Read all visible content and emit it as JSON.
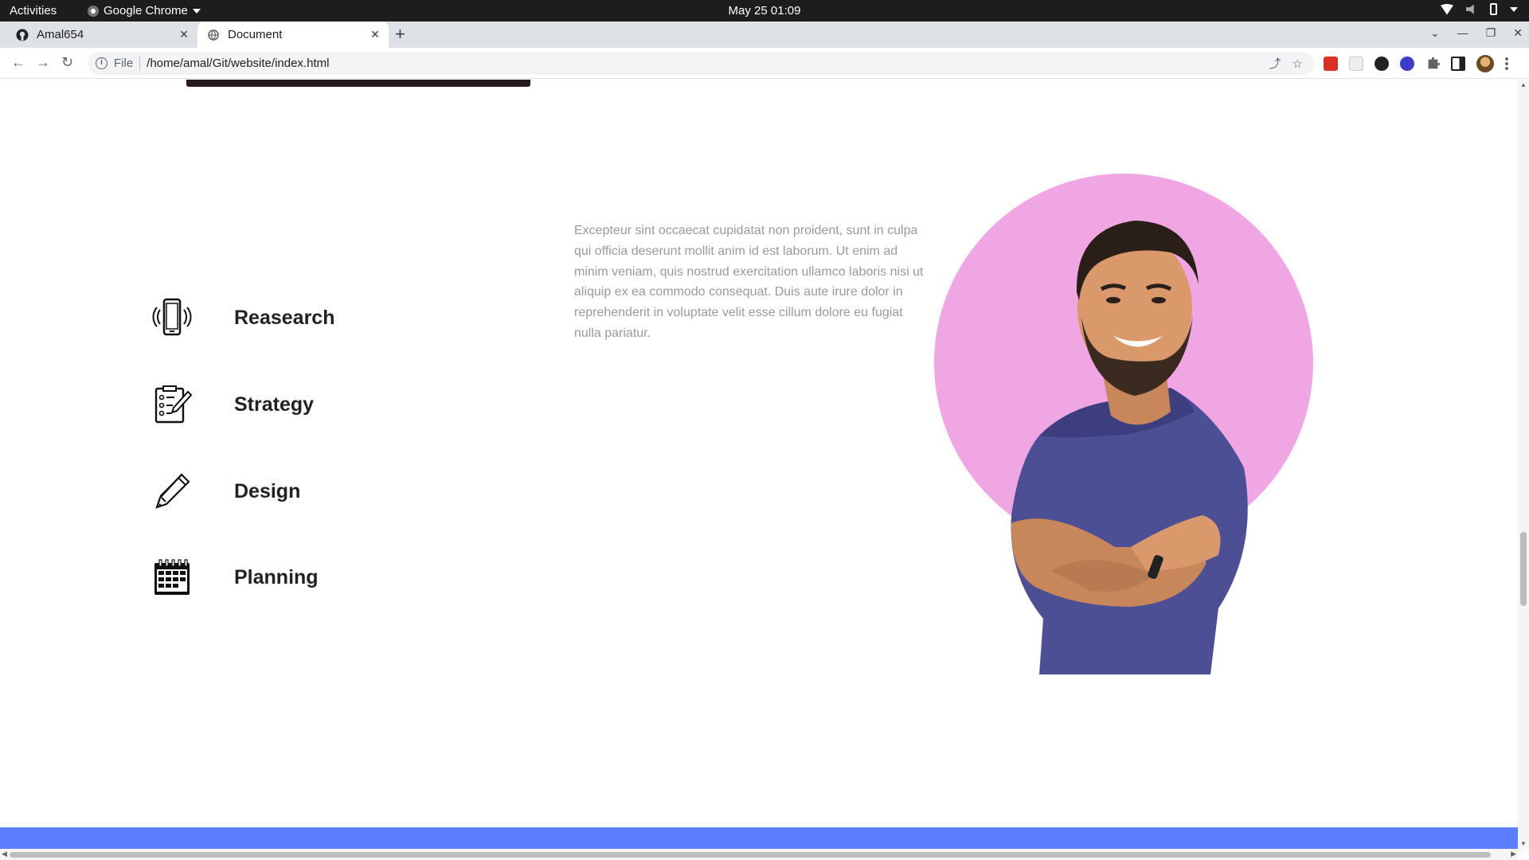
{
  "os": {
    "activities": "Activities",
    "app_name": "Google Chrome",
    "clock": "May 25  01:09"
  },
  "browser": {
    "tabs": [
      {
        "title": "Amal654",
        "icon": "github-icon",
        "active": false
      },
      {
        "title": "Document",
        "icon": "globe-icon",
        "active": true
      }
    ],
    "address": {
      "scheme": "File",
      "url": "/home/amal/Git/website/index.html"
    },
    "extensions": [
      "red-extension-icon",
      "blank-extension-icon",
      "openai-extension-icon",
      "blue-extension-icon",
      "puzzle-icon",
      "side-panel-icon",
      "profile-avatar",
      "menu-icon"
    ]
  },
  "page": {
    "services": [
      {
        "label": "Reasearch",
        "icon": "smartphone-vibrate-icon"
      },
      {
        "label": "Strategy",
        "icon": "checklist-pencil-icon"
      },
      {
        "label": "Design",
        "icon": "pencil-icon"
      },
      {
        "label": "Planning",
        "icon": "calendar-icon"
      }
    ],
    "paragraph": "Excepteur sint occaecat cupidatat non proident, sunt in culpa qui officia deserunt mollit anim id est laborum. Ut enim ad minim veniam, quis nostrud exercitation ullamco laboris nisi ut aliquip ex ea commodo consequat. Duis aute irure dolor in reprehenderit in voluptate velit esse cillum dolore eu fugiat nulla pariatur.",
    "colors": {
      "portrait_circle": "#f0a6e3",
      "footer_band": "#5b7dff",
      "paragraph_text": "#9a9a9a"
    }
  }
}
